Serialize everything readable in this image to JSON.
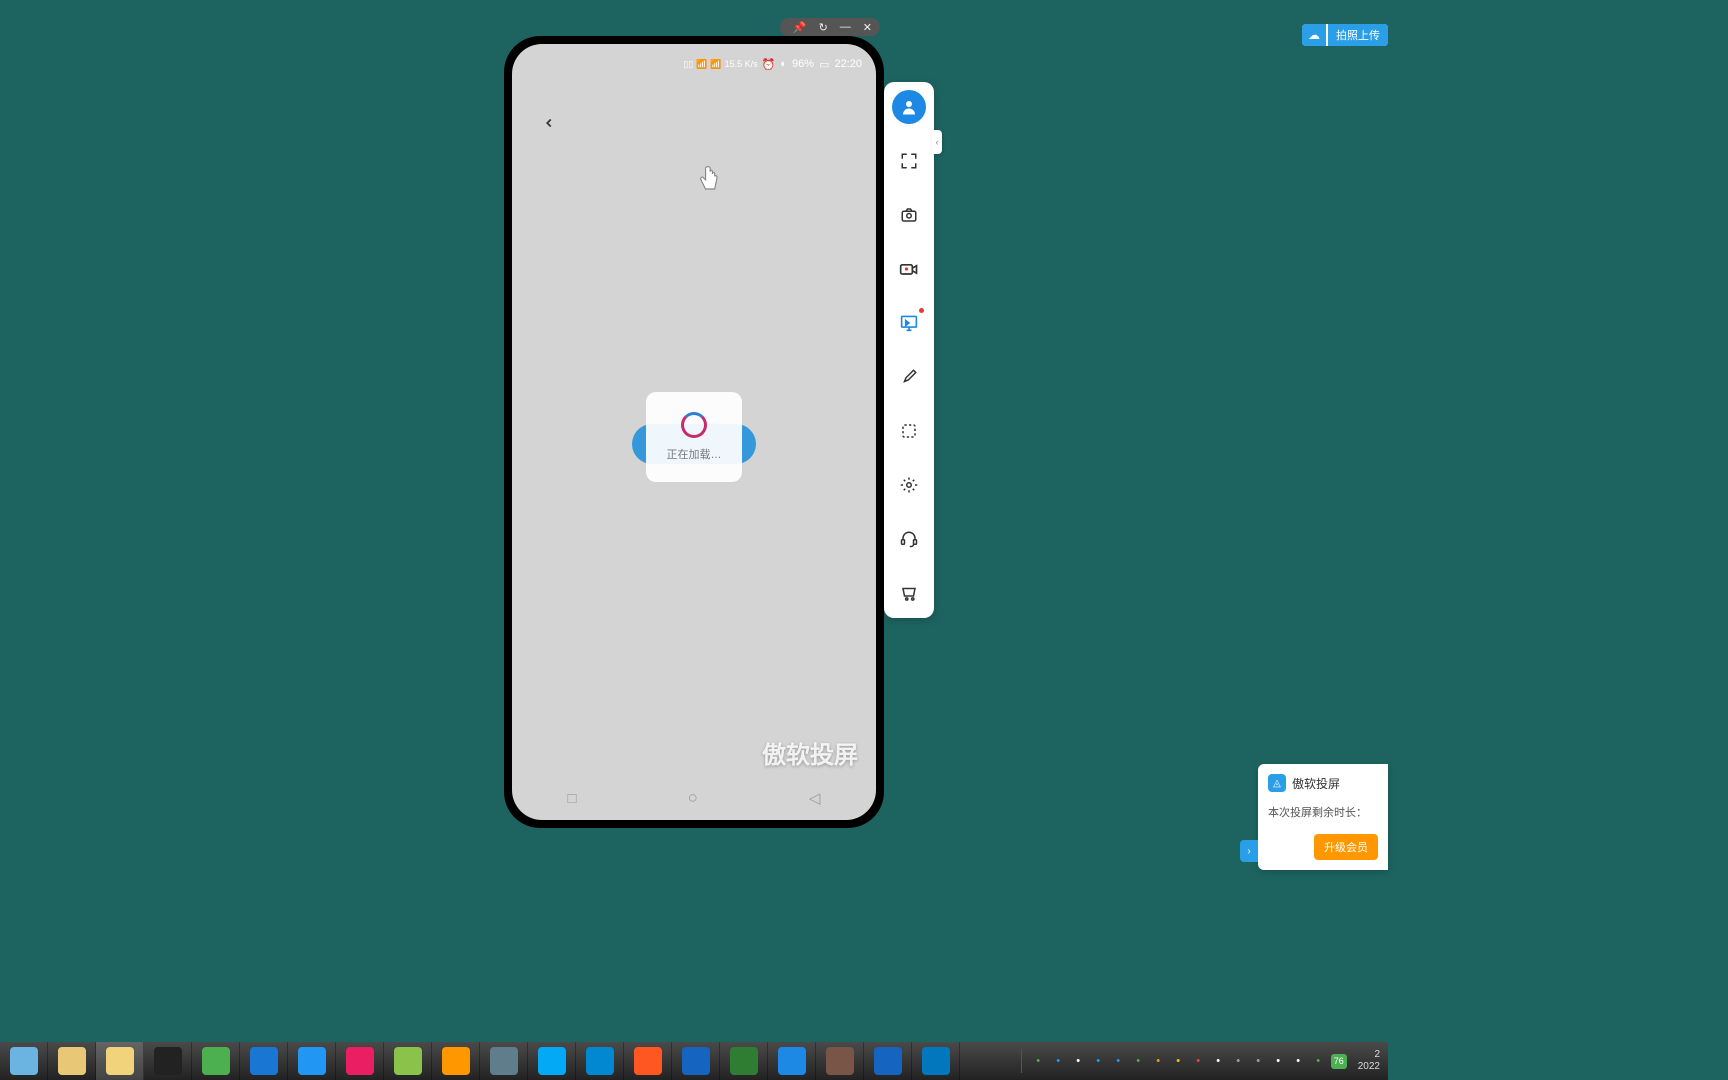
{
  "phone": {
    "status": {
      "speed": "15.5 K/s",
      "battery_pct": "96%",
      "time": "22:20",
      "battery_icon": "battery-icon",
      "signal_icon": "signal-icon",
      "wifi_icon": "wifi-icon",
      "alarm_icon": "alarm-icon"
    },
    "loading_text": "正在加载…",
    "watermark": "傲软投屏",
    "nav": {
      "recent": "□",
      "home": "○",
      "back": "◁"
    }
  },
  "titlebar": {
    "pin": "📌",
    "refresh": "↻",
    "minimize": "—",
    "close": "✕"
  },
  "toolbar": {
    "items": [
      {
        "name": "account-icon",
        "glyph": "user",
        "active": true
      },
      {
        "name": "fullscreen-icon",
        "glyph": "expand"
      },
      {
        "name": "screenshot-icon",
        "glyph": "camera"
      },
      {
        "name": "record-icon",
        "glyph": "video"
      },
      {
        "name": "control-icon",
        "glyph": "monitor",
        "selected": true,
        "dot": true
      },
      {
        "name": "brush-icon",
        "glyph": "brush"
      },
      {
        "name": "crop-icon",
        "glyph": "crop"
      },
      {
        "name": "settings-icon",
        "glyph": "gear"
      },
      {
        "name": "support-icon",
        "glyph": "headset"
      },
      {
        "name": "shop-icon",
        "glyph": "cart"
      }
    ]
  },
  "upload_badge": {
    "label": "拍照上传"
  },
  "notification": {
    "title": "傲软投屏",
    "subtitle": "本次投屏剩余时长：",
    "button": "升级会员"
  },
  "taskbar": {
    "apps": [
      {
        "name": "app-start",
        "color": "#6bb3e0"
      },
      {
        "name": "app-calc",
        "color": "#e8c877"
      },
      {
        "name": "app-explorer",
        "color": "#f0d37a"
      },
      {
        "name": "app-qq",
        "color": "#222"
      },
      {
        "name": "app-wechat",
        "color": "#4caf50"
      },
      {
        "name": "app-u",
        "color": "#1976d2"
      },
      {
        "name": "app-grid",
        "color": "#2196f3"
      },
      {
        "name": "app-heart",
        "color": "#e91e63"
      },
      {
        "name": "app-globe",
        "color": "#8bc34a"
      },
      {
        "name": "app-browser",
        "color": "#ff9800"
      },
      {
        "name": "app-sogou",
        "color": "#607d8b"
      },
      {
        "name": "app-ie",
        "color": "#03a9f4"
      },
      {
        "name": "app-edge",
        "color": "#0288d1"
      },
      {
        "name": "app-firefox",
        "color": "#ff5722"
      },
      {
        "name": "app-bird",
        "color": "#1565c0"
      },
      {
        "name": "app-excel",
        "color": "#2e7d32"
      },
      {
        "name": "app-baidu",
        "color": "#1e88e5"
      },
      {
        "name": "app-qrcode",
        "color": "#795548"
      },
      {
        "name": "app-word",
        "color": "#1565c0"
      },
      {
        "name": "app-apowersoft",
        "color": "#0277bd"
      }
    ],
    "tray_icons": [
      "s-icon",
      "m-icon",
      "circle-icon",
      "wifi-icon",
      "k-icon",
      "msg-icon",
      "cloud-icon",
      "s2-icon",
      "ban-icon",
      "vol-icon",
      "grid1-icon",
      "grid2-icon",
      "tray-icon",
      "circ2-icon",
      "down-icon",
      "badge-76"
    ],
    "clock_time": "2",
    "clock_date": "2022"
  }
}
